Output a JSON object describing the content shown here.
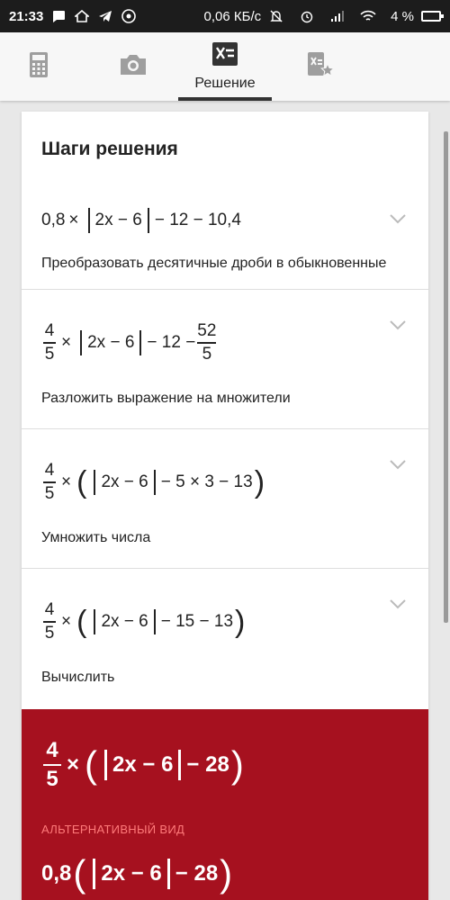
{
  "status_bar": {
    "time": "21:33",
    "network_speed": "0,06 КБ/с",
    "battery": "4 %"
  },
  "tabs": [
    {
      "name": "calculator",
      "label": ""
    },
    {
      "name": "camera",
      "label": ""
    },
    {
      "name": "solution",
      "label": "Решение",
      "active": true
    },
    {
      "name": "saved",
      "label": ""
    }
  ],
  "card": {
    "title": "Шаги решения"
  },
  "steps": [
    {
      "expr_parts": [
        "0,8",
        "×",
        "2x − 6",
        "− 12 − 10,4"
      ],
      "description": "Преобразовать десятичные дроби в обыкновенные"
    },
    {
      "frac": {
        "num": "4",
        "den": "5"
      },
      "expr_parts": [
        "×",
        "2x − 6",
        "− 12 −"
      ],
      "frac2": {
        "num": "52",
        "den": "5"
      },
      "description": "Разложить выражение на множители"
    },
    {
      "frac": {
        "num": "4",
        "den": "5"
      },
      "expr_parts": [
        "×",
        "2x − 6",
        "− 5 × 3 − 13"
      ],
      "description": "Умножить числа"
    },
    {
      "frac": {
        "num": "4",
        "den": "5"
      },
      "expr_parts": [
        "×",
        "2x − 6",
        "− 15 − 13"
      ],
      "description": "Вычислить"
    }
  ],
  "result": {
    "frac": {
      "num": "4",
      "den": "5"
    },
    "expr_parts": [
      "×",
      "2x − 6",
      "− 28"
    ],
    "alt_label": "АЛЬТЕРНАТИВНЫЙ ВИД",
    "alt_expr_parts": [
      "0,8",
      "2x − 6",
      "− 28"
    ]
  },
  "colors": {
    "result_bg": "#a6111f",
    "alt_label": "#ff7a7a",
    "status_bar": "#1c1c1c"
  }
}
